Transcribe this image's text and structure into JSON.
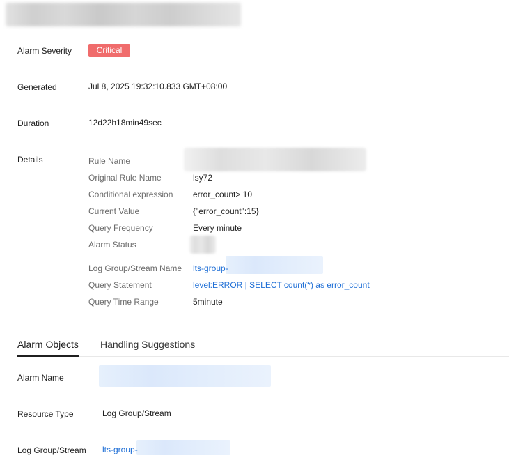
{
  "summary": {
    "severity_label": "Alarm Severity",
    "severity_value": "Critical",
    "generated_label": "Generated",
    "generated_value": "Jul 8, 2025 19:32:10.833 GMT+08:00",
    "duration_label": "Duration",
    "duration_value": "12d22h18min49sec",
    "details_label": "Details"
  },
  "details": {
    "rule_name_label": "Rule Name",
    "original_rule_name_label": "Original Rule Name",
    "original_rule_name_value": "lsy72",
    "conditional_expression_label": "Conditional expression",
    "conditional_expression_value": "error_count> 10",
    "current_value_label": "Current Value",
    "current_value_value": "{\"error_count\":15}",
    "query_frequency_label": "Query Frequency",
    "query_frequency_value": "Every minute",
    "alarm_status_label": "Alarm Status",
    "log_group_stream_label": "Log Group/Stream Name",
    "log_group_stream_prefix": "lts-group-",
    "query_statement_label": "Query Statement",
    "query_statement_value": "level:ERROR | SELECT count(*) as error_count",
    "query_time_range_label": "Query Time Range",
    "query_time_range_value": "5minute"
  },
  "tabs": {
    "alarm_objects": "Alarm Objects",
    "handling_suggestions": "Handling Suggestions",
    "active": "alarm_objects"
  },
  "alarm_objects": {
    "alarm_name_label": "Alarm Name",
    "resource_type_label": "Resource Type",
    "resource_type_value": "Log Group/Stream",
    "log_group_stream_label": "Log Group/Stream",
    "log_group_stream_prefix": "lts-group-"
  },
  "colors": {
    "critical_badge": "#f06c6c",
    "link": "#1f6fd6",
    "active_tab_underline": "#1f1f1f"
  }
}
